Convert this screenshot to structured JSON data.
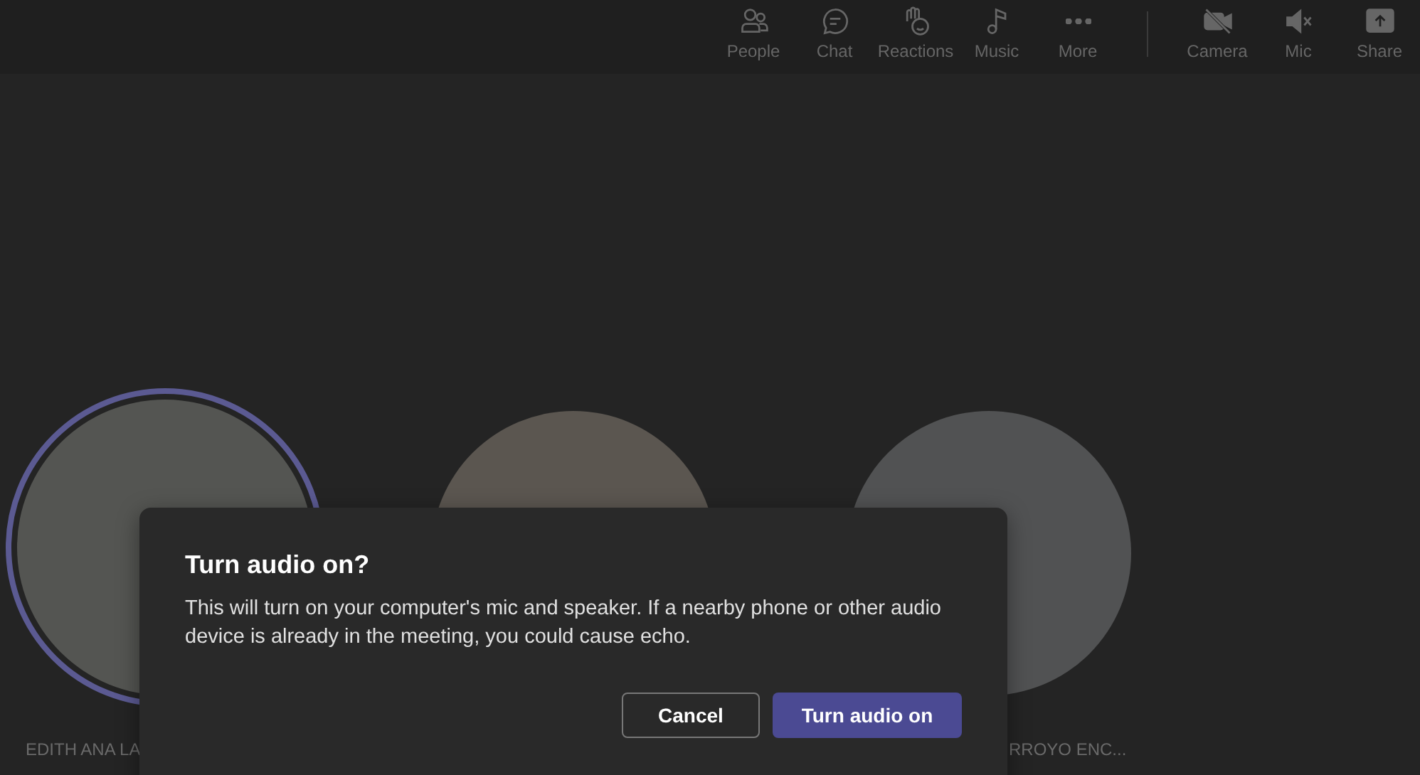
{
  "toolbar": [
    {
      "kind": "people",
      "label": "People"
    },
    {
      "kind": "chat",
      "label": "Chat"
    },
    {
      "kind": "reactions",
      "label": "Reactions"
    },
    {
      "kind": "music",
      "label": "Music"
    },
    {
      "kind": "more",
      "label": "More"
    },
    {
      "kind": "camera",
      "label": "Camera"
    },
    {
      "kind": "mic",
      "label": "Mic"
    },
    {
      "kind": "share",
      "label": "Share"
    }
  ],
  "participants": [
    {
      "name": "EDITH ANA LA",
      "speaking": true,
      "color": "#545552"
    },
    {
      "speaking": false,
      "color": "#5b5650"
    },
    {
      "name": "RROYO ENC...",
      "speaking": false,
      "color": "#515253"
    }
  ],
  "dialog": {
    "title": "Turn audio on?",
    "message": "This will turn on your computer's mic and speaker. If a nearby phone or other audio device is already in the meeting, you could cause echo.",
    "buttons": [
      {
        "kind": "secondary",
        "label": "Cancel"
      },
      {
        "kind": "primary",
        "label": "Turn audio on"
      }
    ]
  }
}
